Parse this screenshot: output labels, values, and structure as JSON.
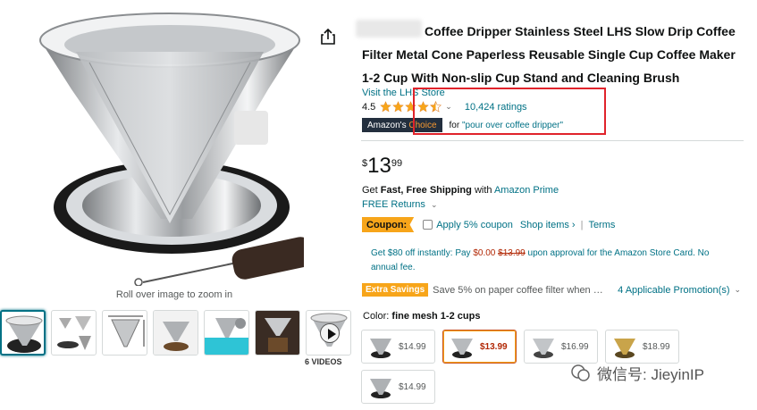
{
  "product": {
    "title": "Coffee Dripper Stainless Steel LHS Slow Drip Coffee Filter Metal Cone Paperless Reusable Single Cup Coffee Maker 1-2 Cup With Non-slip Cup Stand and Cleaning Brush",
    "store_link": "Visit the LHS Store",
    "rating_value": "4.5",
    "rating_stars": 4.5,
    "ratings_count": "10,424 ratings",
    "badge_amazons": "Amazon's",
    "badge_choice": "Choice",
    "badge_for": "for",
    "badge_query": "\"pour over coffee dripper\""
  },
  "price": {
    "currency": "$",
    "whole": "13",
    "fraction": "99"
  },
  "shipping": {
    "get": "Get",
    "fast": "Fast, Free Shipping",
    "with": "with",
    "prime": "Amazon Prime",
    "free_returns": "FREE Returns"
  },
  "coupon": {
    "badge": "Coupon:",
    "apply": "Apply 5% coupon",
    "shop_items": "Shop items ›",
    "pipe": "|",
    "terms": "Terms"
  },
  "store_card": {
    "prefix": "Get $80 off instantly: Pay",
    "pay": "$0.00",
    "original": "$13.99",
    "suffix": "upon approval for the Amazon Store Card. No annual fee."
  },
  "savings": {
    "badge": "Extra Savings",
    "text": "Save 5% on paper coffee filter when …",
    "promotions": "4 Applicable Promotion(s)"
  },
  "image": {
    "roll_over": "Roll over image to zoom in",
    "videos_label": "6 VIDEOS"
  },
  "color": {
    "label": "Color:",
    "value": "fine mesh 1-2 cups"
  },
  "swatches": [
    {
      "price": "$14.99",
      "selected": false
    },
    {
      "price": "$13.99",
      "selected": true
    },
    {
      "price": "$16.99",
      "selected": false
    },
    {
      "price": "$18.99",
      "selected": false
    },
    {
      "price": "$14.99",
      "selected": false
    }
  ],
  "watermark": "微信号: JieyinIP",
  "colors": {
    "link": "#007185",
    "price_red": "#B12704",
    "badge_dark": "#232F3E",
    "badge_orange": "#F7A51A",
    "annotation_red": "#E0232B"
  }
}
